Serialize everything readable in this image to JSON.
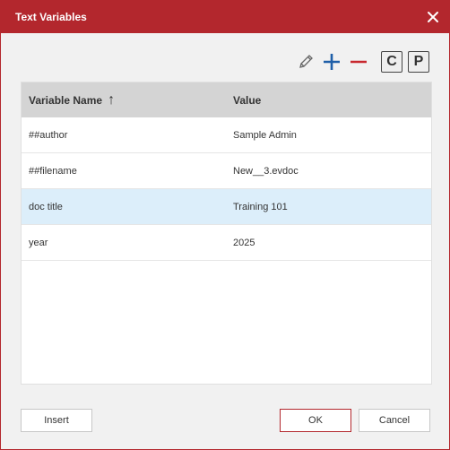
{
  "dialog": {
    "title": "Text Variables"
  },
  "toolbar": {
    "edit_icon": "pencil-icon",
    "add_icon": "plus-icon",
    "remove_icon": "minus-icon",
    "c_label": "C",
    "p_label": "P"
  },
  "table": {
    "columns": [
      "Variable Name",
      "Value"
    ],
    "sort_indicator": "↑",
    "rows": [
      {
        "name": "##author",
        "value": "Sample Admin"
      },
      {
        "name": "##filename",
        "value": "New__3.evdoc"
      },
      {
        "name": "doc title",
        "value": "Training 101"
      },
      {
        "name": "year",
        "value": "2025"
      }
    ],
    "selected_row": 2
  },
  "footer": {
    "insert_label": "Insert",
    "ok_label": "OK",
    "cancel_label": "Cancel"
  },
  "colors": {
    "accent": "#b3272d",
    "plus": "#1f5fa8",
    "minus": "#c8282e",
    "selected_row": "#dceefa"
  }
}
